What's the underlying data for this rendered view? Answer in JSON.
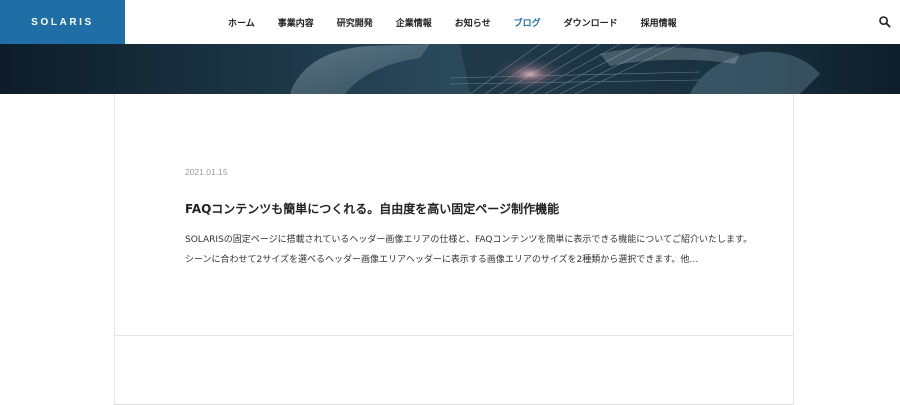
{
  "header": {
    "logo_text": "SOLARIS",
    "accent_color": "#1f6fa6",
    "nav": [
      {
        "label": "ホーム",
        "active": false
      },
      {
        "label": "事業内容",
        "active": false
      },
      {
        "label": "研究開発",
        "active": false
      },
      {
        "label": "企業情報",
        "active": false
      },
      {
        "label": "お知らせ",
        "active": false
      },
      {
        "label": "ブログ",
        "active": true
      },
      {
        "label": "ダウンロード",
        "active": false
      },
      {
        "label": "採用情報",
        "active": false
      }
    ],
    "search_icon": "search-icon"
  },
  "article": {
    "date": "2021.01.15",
    "title": "FAQコンテンツも簡単につくれる。自由度を高い固定ページ制作機能",
    "excerpt": "SOLARISの固定ページに搭載されているヘッダー画像エリアの仕様と、FAQコンテンツを簡単に表示できる機能についてご紹介いたします。シーンに合わせて2サイズを選べるヘッダー画像エリアヘッダーに表示する画像エリアのサイズを2種類から選択できます。他…"
  }
}
